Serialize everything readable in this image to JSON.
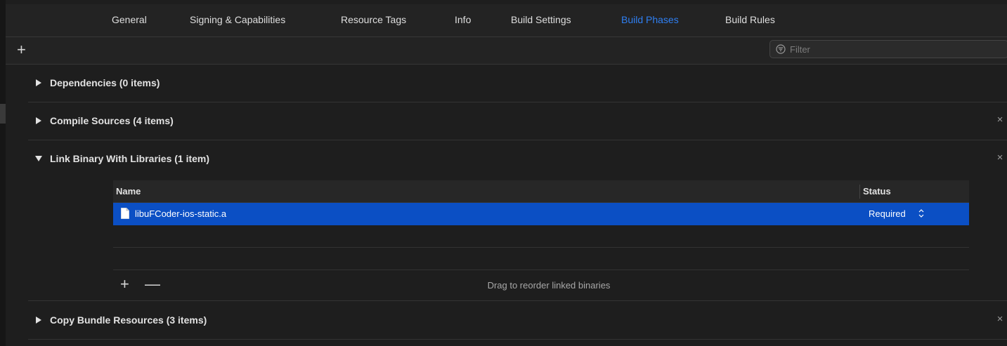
{
  "tabs": [
    {
      "label": "General",
      "active": false
    },
    {
      "label": "Signing & Capabilities",
      "active": false
    },
    {
      "label": "Resource Tags",
      "active": false
    },
    {
      "label": "Info",
      "active": false
    },
    {
      "label": "Build Settings",
      "active": false
    },
    {
      "label": "Build Phases",
      "active": true
    },
    {
      "label": "Build Rules",
      "active": false
    }
  ],
  "toolbar": {
    "add_icon": "plus-icon",
    "filter_placeholder": "Filter",
    "filter_value": "",
    "filter_icon": "filter-circle-icon"
  },
  "phases": [
    {
      "title": "Dependencies (0 items)",
      "expanded": false,
      "removable": false
    },
    {
      "title": "Compile Sources (4 items)",
      "expanded": false,
      "removable": true
    },
    {
      "title": "Link Binary With Libraries (1 item)",
      "expanded": true,
      "removable": true
    },
    {
      "title": "Copy Bundle Resources (3 items)",
      "expanded": false,
      "removable": true
    }
  ],
  "link_table": {
    "col_name": "Name",
    "col_status": "Status",
    "rows": [
      {
        "name": "libuFCoder-ios-static.a",
        "status": "Required",
        "selected": true
      }
    ],
    "drag_hint": "Drag to reorder linked binaries"
  },
  "symbols": {
    "plus": "+",
    "minus": "—",
    "close": "×"
  },
  "colors": {
    "accent": "#2f7ff2",
    "selection": "#0b4fc4",
    "background": "#1e1e1e"
  }
}
